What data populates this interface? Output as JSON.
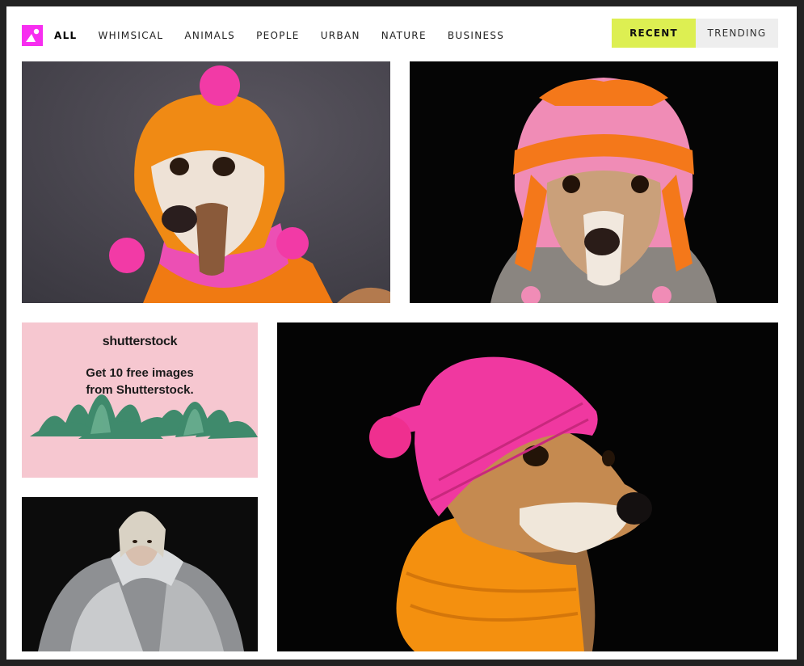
{
  "nav": {
    "items": [
      {
        "label": "ALL",
        "active": true
      },
      {
        "label": "WHIMSICAL",
        "active": false
      },
      {
        "label": "ANIMALS",
        "active": false
      },
      {
        "label": "PEOPLE",
        "active": false
      },
      {
        "label": "URBAN",
        "active": false
      },
      {
        "label": "NATURE",
        "active": false
      },
      {
        "label": "BUSINESS",
        "active": false
      }
    ]
  },
  "tabs": {
    "recent_label": "RECENT",
    "trending_label": "TRENDING",
    "active": "RECENT"
  },
  "colors": {
    "brand": "#f72ef0",
    "accent": "#ddef52"
  },
  "ad": {
    "brand": "shutterstock",
    "text_line1": "Get 10 free images",
    "text_line2": "from Shutterstock."
  },
  "gallery": [
    {
      "subject": "dog-orange-knit-hat",
      "background": "gray"
    },
    {
      "subject": "dog-pink-orange-knit-hat",
      "background": "black"
    },
    {
      "subject": "dog-pink-beanie-orange-scarf",
      "background": "black"
    },
    {
      "subject": "woman-silver-puffer-jacket",
      "background": "black"
    }
  ]
}
